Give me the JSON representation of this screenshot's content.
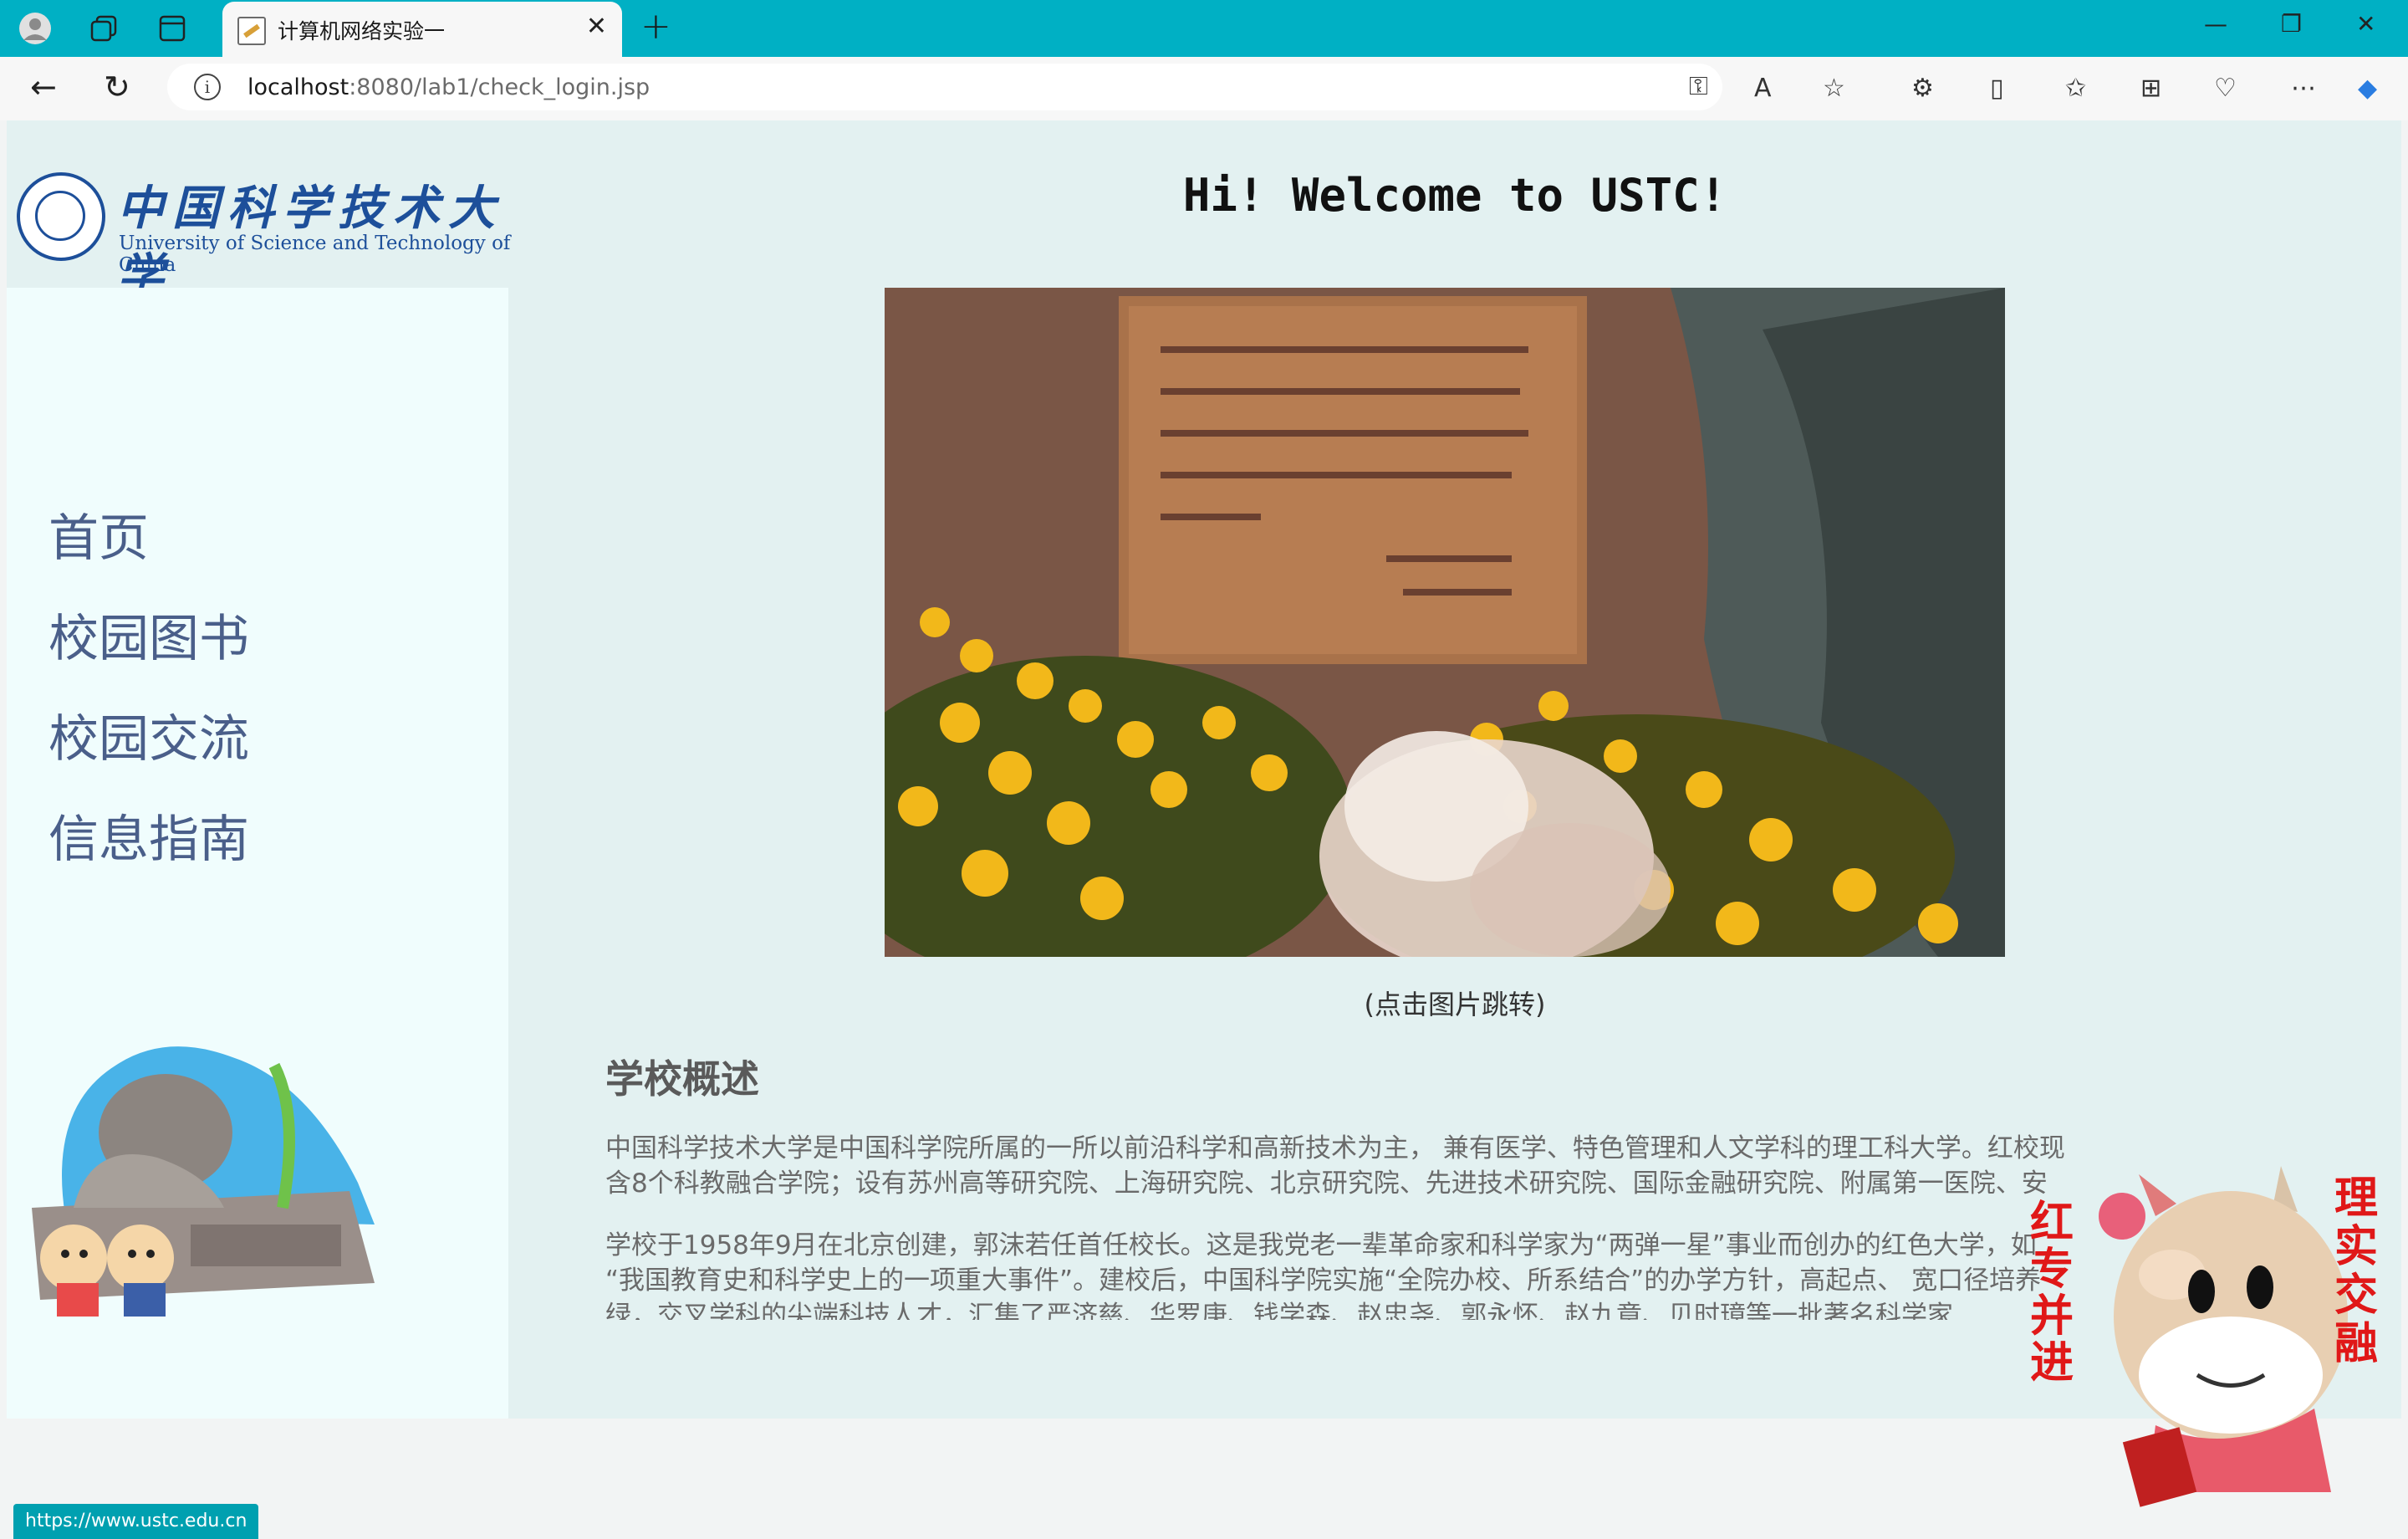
{
  "browser": {
    "tab_title": "计算机网络实验一",
    "url_host": "localhost",
    "url_rest": ":8080/lab1/check_login.jsp",
    "status_url": "https://www.ustc.edu.cn"
  },
  "logo": {
    "cn": "中国科学技术大学",
    "en": "University of Science and Technology of China"
  },
  "menu": [
    "首页",
    "校园图书",
    "校园交流",
    "信息指南"
  ],
  "main": {
    "greeting": "Hi! Welcome to USTC!",
    "caption": "(点击图片跳转)",
    "section_title": "学校概述",
    "p1_line1": "中国科学技术大学是中国科学院所属的一所以前沿科学和高新技术为主， 兼有医学、特色管理和人文学科的理工科大学。红校现",
    "p1_line2": "含8个科教融合学院；设有苏州高等研究院、上海研究院、北京研究院、先进技术研究院、国际金融研究院、附属第一医院、安",
    "p2_line1": "学校于1958年9月在北京创建，郭沫若任首任校长。这是我党老一辈革命家和科学家为“两弹一星”事业而创办的红色大学，如",
    "p2_line2": "“我国教育史和科学史上的一项重大事件”。建校后，中国科学院实施“全院办校、所系结合”的办学方针，高起点、 宽口径培养",
    "p2_line3": "绿，交叉学科的尖端科技人才，汇集了严济慈、华罗庚、钱学森、赵忠尧、郭永怀、赵九章、贝时璋等一批著名科学家"
  },
  "cow_banner": {
    "left": "红专并进",
    "right": "理实交融"
  },
  "colors": {
    "titlebar": "#00b0c4",
    "page_bg": "#e3f1f1",
    "sidebar_bg": "#f0fdfd",
    "logo_blue": "#1d4f9a",
    "menu_text": "#4a5f8a"
  }
}
